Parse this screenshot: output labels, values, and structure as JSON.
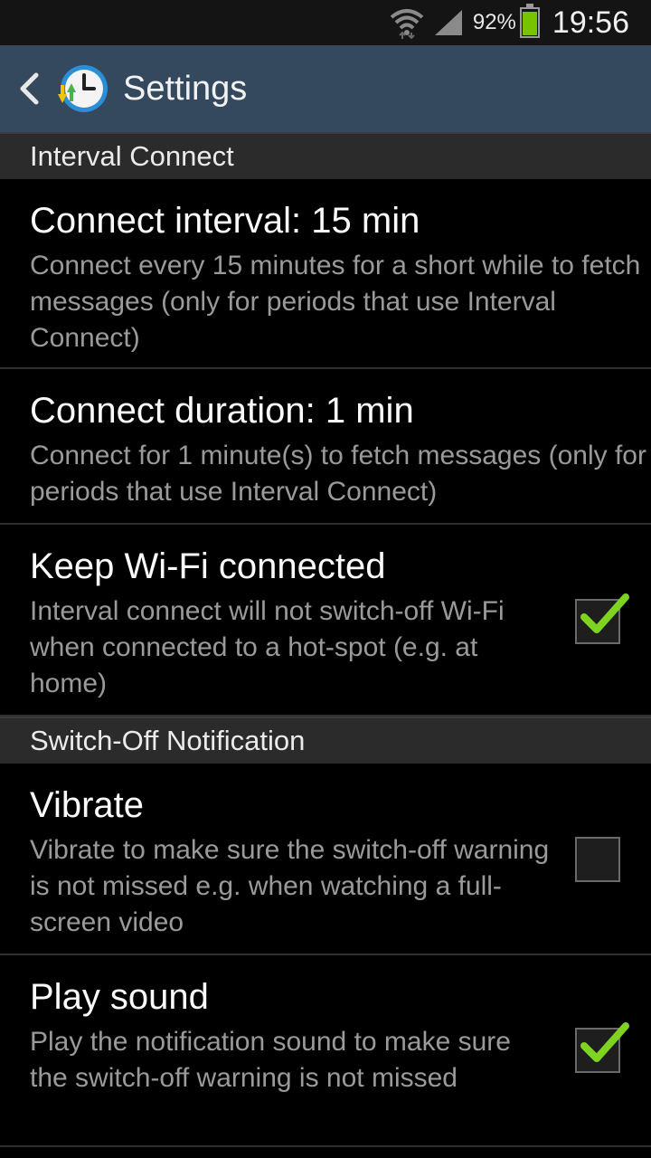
{
  "status_bar": {
    "battery_percent": "92%",
    "battery_level": 0.92,
    "time": "19:56",
    "icons": [
      "wifi-icon",
      "signal-icon",
      "battery-icon"
    ]
  },
  "action_bar": {
    "title": "Settings",
    "back_icon": "chevron-left-icon",
    "app_icon": "clock-sync-icon"
  },
  "sections": [
    {
      "header": "Interval Connect",
      "items": [
        {
          "title": "Connect interval: 15 min",
          "summary": "Connect every 15 minutes for a short while to fetch messages (only for periods that use Interval Connect)"
        },
        {
          "title": "Connect duration: 1 min",
          "summary": "Connect for 1 minute(s) to fetch messages (only for periods that use Interval Connect)"
        },
        {
          "title": "Keep Wi-Fi connected",
          "summary": "Interval connect will not switch-off Wi-Fi when connected to a hot-spot (e.g. at home)",
          "checked": true
        }
      ]
    },
    {
      "header": "Switch-Off Notification",
      "items": [
        {
          "title": "Vibrate",
          "summary": "Vibrate to make sure the switch-off warning is not missed e.g. when watching a full-screen video",
          "checked": false
        },
        {
          "title": "Play sound",
          "summary": "Play the notification sound to make sure the switch-off warning is not missed",
          "checked": true
        }
      ]
    }
  ],
  "colors": {
    "action_bar": "#35495e",
    "check_green": "#7ed321",
    "battery_green": "#76c400"
  }
}
